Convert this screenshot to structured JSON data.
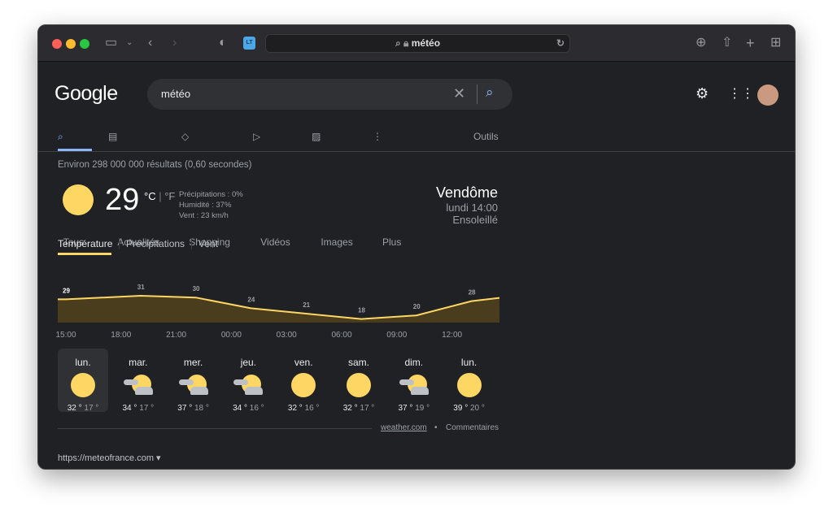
{
  "browser": {
    "url": "météo"
  },
  "google": {
    "logo": "Google",
    "query": "météo",
    "tabs": [
      "Tous",
      "Actualités",
      "Shopping",
      "Vidéos",
      "Images",
      "Plus"
    ],
    "tools": "Outils",
    "result_stats": "Environ 298 000 000 résultats (0,60 secondes)"
  },
  "weather": {
    "temp": "29",
    "unit_c": "°C",
    "unit_f": "°F",
    "precip": "Précipitations : 0%",
    "humidity": "Humidité : 37%",
    "wind": "Vent : 23 km/h",
    "location": "Vendôme",
    "time": "lundi 14:00",
    "condition": "Ensoleillé",
    "tabs": [
      "Température",
      "Précipitations",
      "Vent"
    ],
    "hours": [
      "15:00",
      "18:00",
      "21:00",
      "00:00",
      "03:00",
      "06:00",
      "09:00",
      "12:00"
    ],
    "hour_temps": [
      "29",
      "31",
      "30",
      "24",
      "21",
      "18",
      "20",
      "28"
    ],
    "days": [
      {
        "day": "lun.",
        "icon": "sun",
        "hi": "32 °",
        "lo": "17 °"
      },
      {
        "day": "mar.",
        "icon": "partly-cloudy",
        "hi": "34 °",
        "lo": "17 °"
      },
      {
        "day": "mer.",
        "icon": "partly-cloudy",
        "hi": "37 °",
        "lo": "18 °"
      },
      {
        "day": "jeu.",
        "icon": "partly-cloudy",
        "hi": "34 °",
        "lo": "16 °"
      },
      {
        "day": "ven.",
        "icon": "sun",
        "hi": "32 °",
        "lo": "16 °"
      },
      {
        "day": "sam.",
        "icon": "sun",
        "hi": "32 °",
        "lo": "17 °"
      },
      {
        "day": "dim.",
        "icon": "partly-cloudy",
        "hi": "37 °",
        "lo": "19 °"
      },
      {
        "day": "lun.",
        "icon": "sun",
        "hi": "39 °",
        "lo": "20 °"
      }
    ],
    "source": "weather.com",
    "feedback": "Commentaires",
    "accent": "#fdd663"
  },
  "next_result": {
    "url": "https://meteofrance.com"
  }
}
